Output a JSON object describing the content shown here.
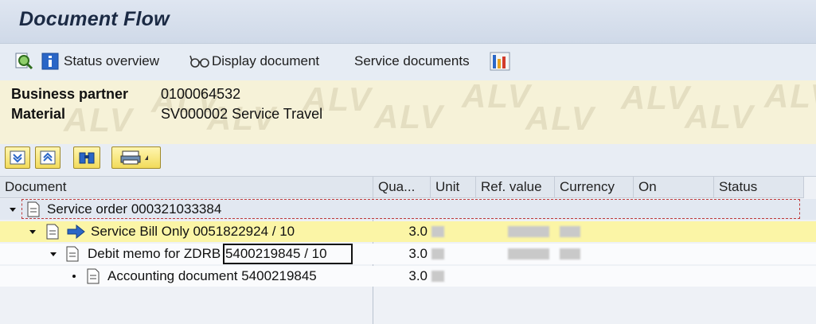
{
  "window": {
    "title": "Document Flow"
  },
  "toolbar": {
    "status_overview_label": "Status overview",
    "display_document_label": "Display document",
    "service_documents_label": "Service documents"
  },
  "header": {
    "business_partner_label": "Business partner",
    "business_partner_value": "0100064532",
    "material_label": "Material",
    "material_value": "SV000002 Service Travel",
    "watermark": "ALV"
  },
  "table": {
    "columns": [
      "Document",
      "Qua...",
      "Unit",
      "Ref. value",
      "Currency",
      "On",
      "Status"
    ],
    "rows": [
      {
        "document": "Service order 000321033384",
        "quantity": "",
        "level": 0
      },
      {
        "document": "Service Bill Only 0051822924 / 10",
        "quantity": "3.0",
        "level": 1
      },
      {
        "document_prefix": "Debit memo for ZDRB ",
        "document_highlight": "5400219845 / 10",
        "quantity": "3.0",
        "level": 2
      },
      {
        "document": "Accounting document 5400219845",
        "quantity": "3.0",
        "level": 3
      }
    ]
  },
  "colors": {
    "header_bg": "#f6f2d8",
    "selected_row_bg": "#fbf5a6",
    "accent_blue": "#2a66c7"
  }
}
